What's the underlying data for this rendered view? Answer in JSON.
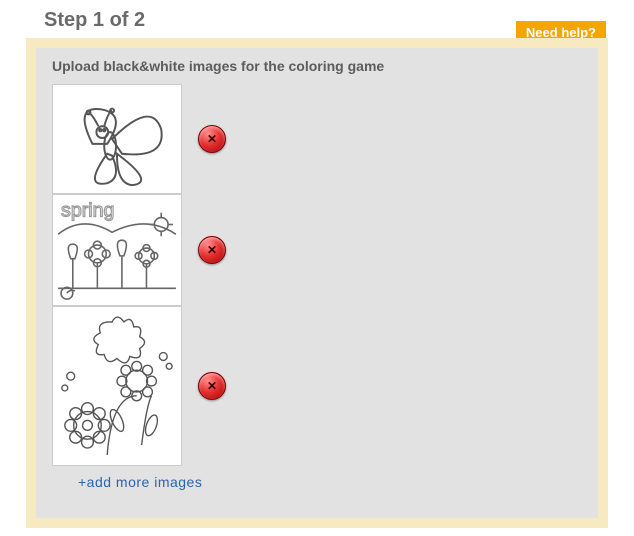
{
  "header": {
    "step_title": "Step 1 of 2",
    "help_label": "Need help?"
  },
  "panel": {
    "instruction": "Upload black&white images for the coloring game",
    "thumbnails": [
      {
        "alt": "butterfly coloring page"
      },
      {
        "alt": "spring flowers coloring page"
      },
      {
        "alt": "flowers coloring page"
      }
    ],
    "delete_symbol": "✕",
    "add_more_label": "+add more images"
  }
}
